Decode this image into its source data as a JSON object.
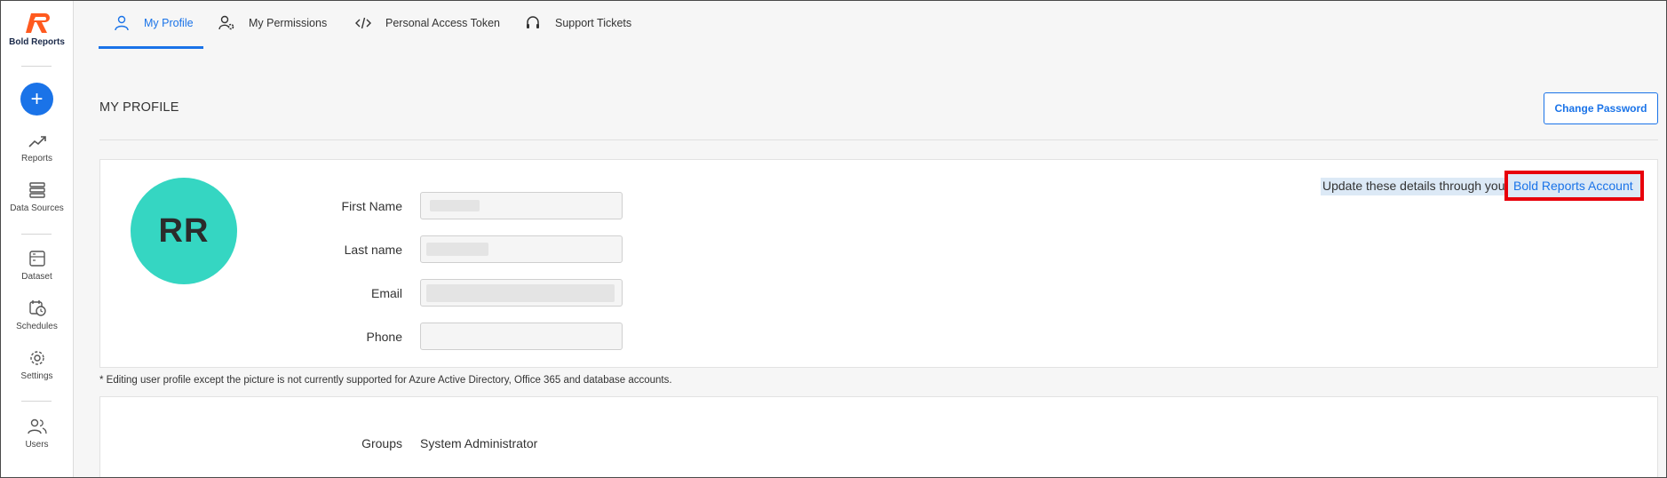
{
  "brand": {
    "name": "Bold Reports",
    "accent": "#ff5a1f"
  },
  "sidebar": {
    "add_label": "+",
    "items": [
      {
        "label": "Reports",
        "icon": "trending-up-icon"
      },
      {
        "label": "Data Sources",
        "icon": "server-icon"
      },
      {
        "label": "Dataset",
        "icon": "dataset-icon"
      },
      {
        "label": "Schedules",
        "icon": "calendar-clock-icon"
      },
      {
        "label": "Settings",
        "icon": "gear-icon"
      },
      {
        "label": "Users",
        "icon": "users-icon"
      }
    ]
  },
  "tabs": [
    {
      "label": "My Profile",
      "icon": "user-icon",
      "active": true
    },
    {
      "label": "My Permissions",
      "icon": "user-gear-icon",
      "active": false
    },
    {
      "label": "Personal Access Token",
      "icon": "code-icon",
      "active": false
    },
    {
      "label": "Support Tickets",
      "icon": "headset-icon",
      "active": false
    }
  ],
  "page": {
    "title": "MY PROFILE",
    "change_password": "Change Password"
  },
  "profile": {
    "initials": "RR",
    "fields": [
      {
        "label": "First Name",
        "value": ""
      },
      {
        "label": "Last name",
        "value": ""
      },
      {
        "label": "Email",
        "value": ""
      },
      {
        "label": "Phone",
        "value": ""
      }
    ],
    "update_note": "Update these details through you",
    "account_link": "Bold Reports Account",
    "footnote": "* Editing user profile except the picture is not currently supported for Azure Active Directory, Office 365 and database accounts."
  },
  "groups": {
    "label": "Groups",
    "value": "System Administrator"
  },
  "colors": {
    "primary": "#1a73e8",
    "avatar": "#35d6c2",
    "highlight": "#e8000b"
  }
}
